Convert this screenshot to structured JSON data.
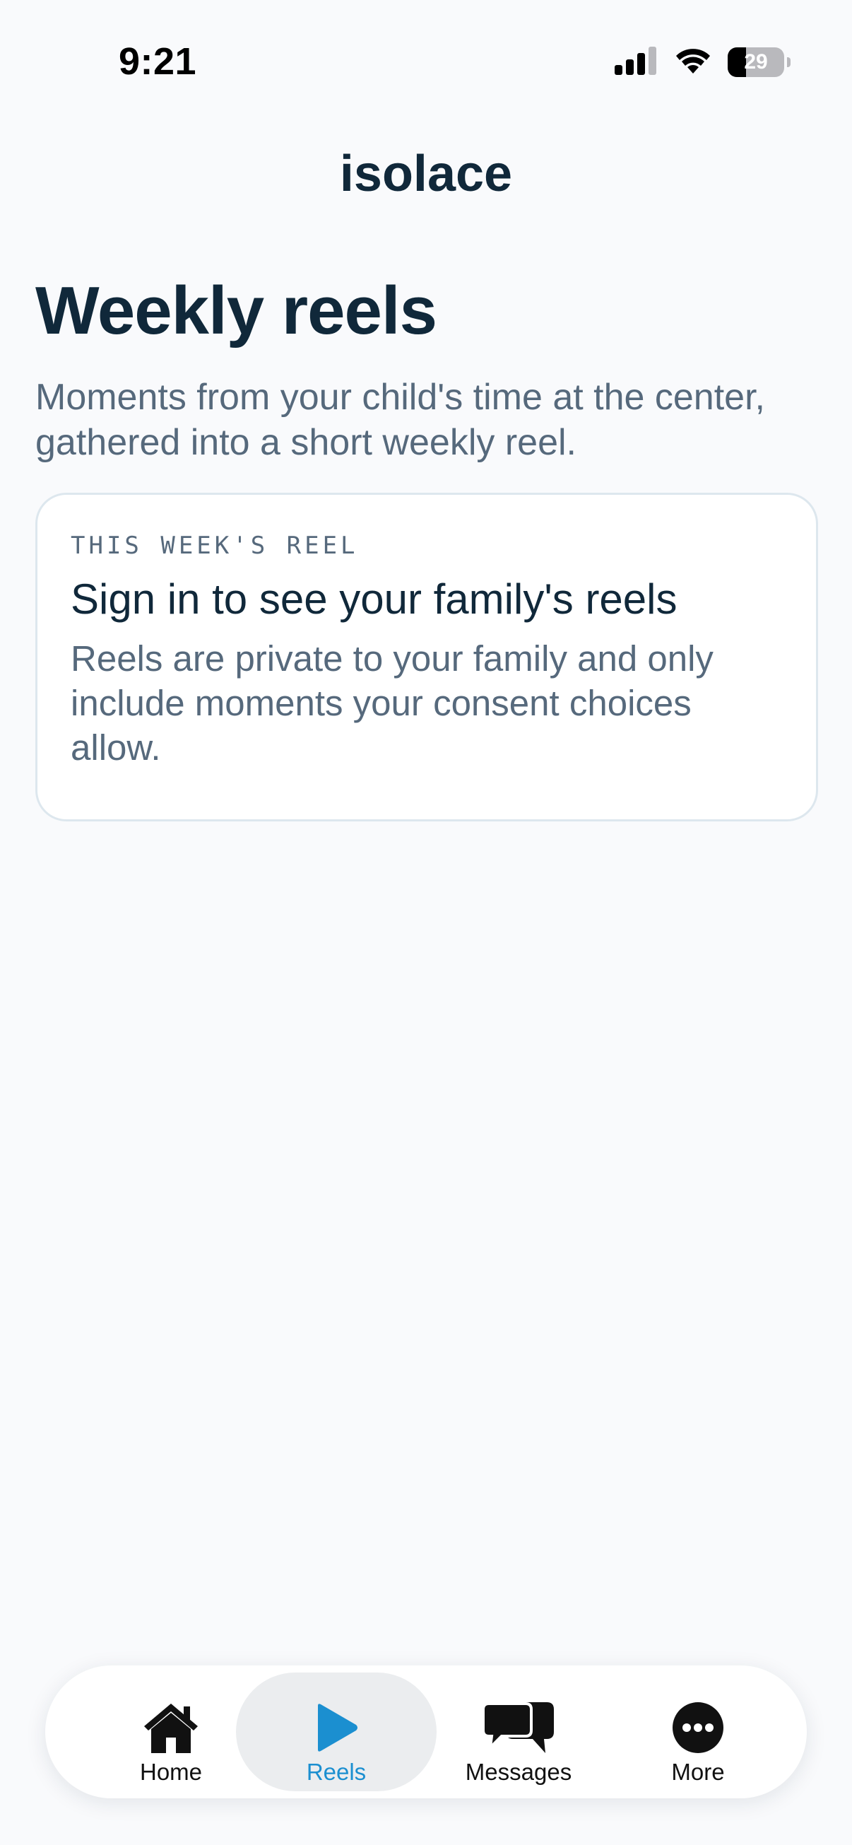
{
  "status_bar": {
    "time": "9:21",
    "battery_level": "29",
    "icons": [
      "cellular-signal-icon",
      "wifi-icon",
      "battery-icon"
    ]
  },
  "header": {
    "app_title": "isolace"
  },
  "main": {
    "title": "Weekly reels",
    "subtitle": "Moments from your child's time at the center, gathered into a short weekly reel.",
    "card": {
      "eyebrow": "THIS WEEK'S REEL",
      "title": "Sign in to see your family's reels",
      "body": "Reels are private to your family and only include moments your consent choices allow."
    }
  },
  "tab_bar": {
    "active": "Reels",
    "tabs": [
      {
        "label": "Home",
        "icon": "house-icon"
      },
      {
        "label": "Reels",
        "icon": "play-icon"
      },
      {
        "label": "Messages",
        "icon": "chat-bubbles-icon"
      },
      {
        "label": "More",
        "icon": "more-dots-icon"
      }
    ]
  },
  "colors": {
    "background": "#f9fafc",
    "text_primary": "#10283a",
    "text_secondary": "#56697c",
    "accent": "#1b8fd0",
    "card_border": "#dde7ee",
    "active_tab_bg": "#ebedef"
  }
}
